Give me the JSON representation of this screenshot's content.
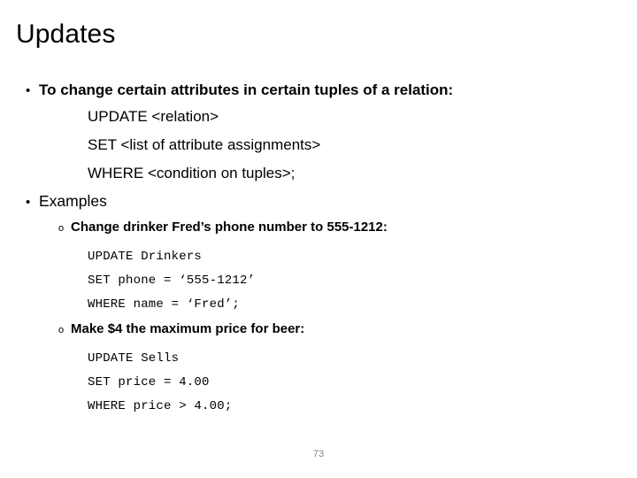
{
  "slide": {
    "title": "Updates",
    "page_number": "73",
    "bullet_glyph": "•",
    "subbullet_glyph": "o",
    "page_number_color": "#808080",
    "text_color": "#000000",
    "background_color": "#ffffff"
  },
  "content": {
    "bullet1": "To change certain attributes in certain tuples of a relation:",
    "syntax": [
      "UPDATE <relation>",
      "SET <list of attribute assignments>",
      "WHERE <condition on tuples>;"
    ],
    "bullet2": "Examples",
    "examples": [
      {
        "caption": "Change drinker Fred’s phone number to 555-1212:",
        "code": [
          "UPDATE Drinkers",
          "SET phone = ‘555-1212’",
          "WHERE name = ‘Fred’;"
        ]
      },
      {
        "caption": "Make $4 the maximum price for beer:",
        "code": [
          "UPDATE Sells",
          "SET price = 4.00",
          "WHERE price > 4.00;"
        ]
      }
    ]
  }
}
